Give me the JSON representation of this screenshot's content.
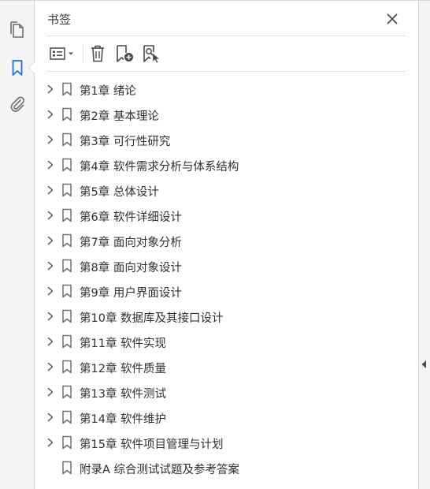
{
  "rail": {
    "items": [
      {
        "name": "pages",
        "icon": "pages-icon"
      },
      {
        "name": "bookmarks",
        "icon": "bookmark-icon",
        "active": true
      },
      {
        "name": "attachments",
        "icon": "paperclip-icon"
      }
    ]
  },
  "panel": {
    "title": "书签",
    "close_icon": "close-icon",
    "toolbar": {
      "options_icon": "list-options-icon",
      "delete_icon": "trash-icon",
      "new_bookmark_icon": "new-bookmark-icon",
      "find_bookmark_icon": "find-bookmark-icon"
    }
  },
  "bookmarks": [
    {
      "label": "第1章 绪论",
      "expandable": true
    },
    {
      "label": "第2章 基本理论",
      "expandable": true
    },
    {
      "label": "第3章 可行性研究",
      "expandable": true
    },
    {
      "label": "第4章 软件需求分析与体系结构",
      "expandable": true
    },
    {
      "label": "第5章 总体设计",
      "expandable": true
    },
    {
      "label": "第6章 软件详细设计",
      "expandable": true
    },
    {
      "label": "第7章 面向对象分析",
      "expandable": true
    },
    {
      "label": "第8章 面向对象设计",
      "expandable": true
    },
    {
      "label": "第9章 用户界面设计",
      "expandable": true
    },
    {
      "label": "第10章 数据库及其接口设计",
      "expandable": true
    },
    {
      "label": "第11章 软件实现",
      "expandable": true
    },
    {
      "label": "第12章 软件质量",
      "expandable": true
    },
    {
      "label": "第13章 软件测试",
      "expandable": true
    },
    {
      "label": "第14章 软件维护",
      "expandable": true
    },
    {
      "label": "第15章 软件项目管理与计划",
      "expandable": true
    },
    {
      "label": "附录A 综合测试试题及参考答案",
      "expandable": false
    }
  ],
  "colors": {
    "icon_gray": "#6e6e6e",
    "icon_blue": "#1473e6",
    "text": "#2f2f2f",
    "divider": "#dedede"
  }
}
